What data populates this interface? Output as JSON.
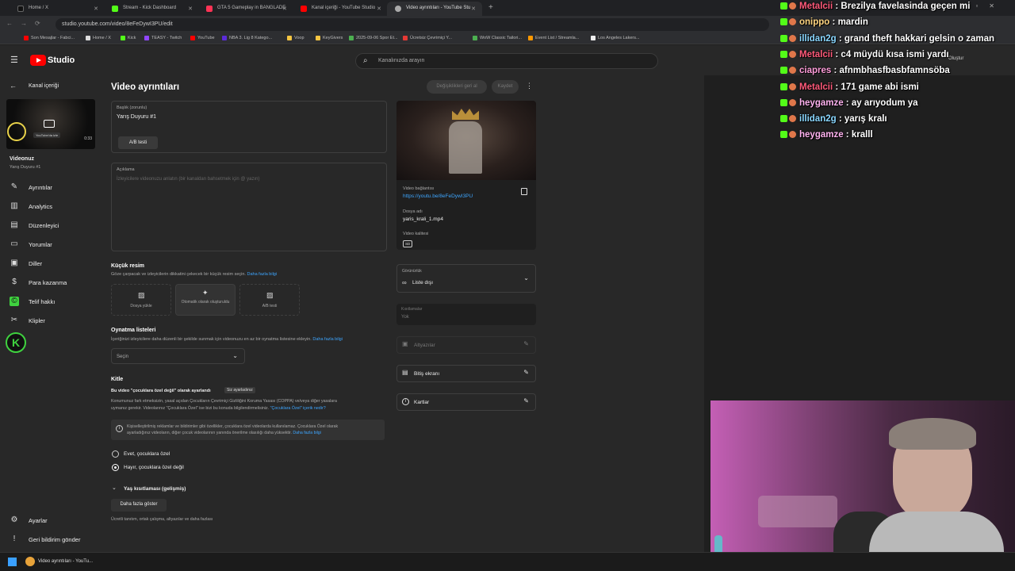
{
  "browser": {
    "tabs": [
      {
        "label": "Home / X",
        "color": "#111111"
      },
      {
        "label": "Stream - Kick Dashboard",
        "color": "#53fc18"
      },
      {
        "label": "GTA 5 Gameplay in BANGLADE",
        "color": "#ff3355"
      },
      {
        "label": "Kanal içeriği - YouTube Studio",
        "color": "#ff0000"
      },
      {
        "label": "Video ayrıntıları - YouTube Stu",
        "color": "#aaaaaa"
      }
    ],
    "url": "studio.youtube.com/video/8eFeDywI3PU/edit",
    "bookmarks": [
      {
        "label": "Son Mesajlar - Fabci...",
        "color": "#ff0000"
      },
      {
        "label": "Home / X",
        "color": "#dddddd"
      },
      {
        "label": "Kick",
        "color": "#53fc18"
      },
      {
        "label": "TEASY - Twitch",
        "color": "#9146ff"
      },
      {
        "label": "YouTube",
        "color": "#ff0000"
      },
      {
        "label": "NBA 3. Lig 8 Katego...",
        "color": "#5b2bd8"
      },
      {
        "label": "Voop",
        "color": "#f5c542"
      },
      {
        "label": "KeyGivers",
        "color": "#f5c542"
      },
      {
        "label": "2025-09-06 Spor Et...",
        "color": "#4caf50"
      },
      {
        "label": "Ücretsiz Çevrimiçi Y...",
        "color": "#e53935"
      },
      {
        "label": "WoW Classic Tailori...",
        "color": "#4caf50"
      },
      {
        "label": "Event List / Streamla...",
        "color": "#ff9800"
      },
      {
        "label": "Los Angeles Lakers...",
        "color": "#eeeeee"
      }
    ]
  },
  "header": {
    "logo": "Studio",
    "search_placeholder": "Kanalınızda arayın",
    "create_label": "Oluştur"
  },
  "sidebar": {
    "back_label": "Kanal içeriği",
    "thumb_time": "0:33",
    "thumb_tooltip": "YouTube'da izle",
    "video_heading": "Videonuz",
    "video_title": "Yarış Duyuru #1",
    "items": [
      {
        "label": "Ayrıntılar",
        "icon": "pencil-icon"
      },
      {
        "label": "Analytics",
        "icon": "analytics-icon"
      },
      {
        "label": "Düzenleyici",
        "icon": "editor-icon"
      },
      {
        "label": "Yorumlar",
        "icon": "comments-icon"
      },
      {
        "label": "Diller",
        "icon": "subtitles-icon"
      },
      {
        "label": "Para kazanma",
        "icon": "dollar-icon"
      },
      {
        "label": "Telif hakkı",
        "icon": "copyright-icon"
      },
      {
        "label": "Klipler",
        "icon": "scissors-icon"
      }
    ],
    "settings_label": "Ayarlar",
    "feedback_label": "Geri bildirim gönder"
  },
  "main": {
    "page_title": "Video ayrıntıları",
    "undo_label": "Değişiklikleri geri al",
    "save_label": "Kaydet",
    "title_field": {
      "label": "Başlık (zorunlu)",
      "value": "Yarış Duyuru #1",
      "ab_label": "A/B testi"
    },
    "description_field": {
      "label": "Açıklama",
      "placeholder": "İzleyicilere videonuzu anlatın (bir kanaldan bahsetmek için @ yazın)"
    },
    "thumbnail": {
      "heading": "Küçük resim",
      "desc": "Göze çarpacak ve izleyicilerin dikkatini çekecek bir küçük resim seçin.",
      "more": "Daha fazla bilgi",
      "options": [
        "Dosya yükle",
        "Otomatik olarak oluşturuldu",
        "A/B testi"
      ]
    },
    "playlists": {
      "heading": "Oynatma listeleri",
      "desc": "İçeriğinizi izleyicilere daha düzenli bir şekilde sunmak için videonuzu en az bir oynatma listesine ekleyin.",
      "more": "Daha fazla bilgi",
      "select": "Seçin"
    },
    "audience": {
      "heading": "Kitle",
      "status": "Bu video \"çocuklara özel değil\" olarak ayarlandı",
      "status_badge": "Siz ayarladınız",
      "desc1": "Konumunuz fark etmeksizin, yasal açıdan Çocukların Çevrimiçi Gizliliğini Koruma Yasası (COPPA) ve/veya diğer yasalara",
      "desc2": "uymanız gerekir. Videolarınız \"Çocuklara Özel\" ise bizi bu konuda bilgilendirmelisiniz.",
      "desc_link": "\"Çocuklara Özel\" içerik nedir?",
      "info1": "Kişiselleştirilmiş reklamlar ve bildirimler gibi özellikler, çocuklara özel videolarda kullanılamaz. Çocuklara Özel olarak",
      "info2": "ayarladığınız videoların, diğer çocuk videolarının yanında önerilme olasılığı daha yüksektir.",
      "info_link": "Daha fazla bilgi",
      "opt_yes": "Evet, çocuklara özel",
      "opt_no": "Hayır, çocuklara özel değil",
      "age_restriction": "Yaş kısıtlaması (gelişmiş)"
    },
    "show_more": "Daha fazla göster",
    "show_more_desc": "Ücretli tanıtım, ortak çalışma, altyazılar ve daha fazlası"
  },
  "right_panel": {
    "video_link_label": "Video bağlantısı",
    "video_link": "https://youtu.be/8eFeDywI3PU",
    "file_label": "Dosya adı",
    "file_name": "yaris_krali_1.mp4",
    "quality_label": "Video kalitesi",
    "quality_badge": "SD",
    "visibility_label": "Görünürlük",
    "visibility_value": "Liste dışı",
    "restrictions_label": "Kısıtlamalar",
    "restrictions_value": "Yok",
    "subtitles": "Altyazılar",
    "end_screen": "Bitiş ekranı",
    "cards": "Kartlar"
  },
  "chat": [
    {
      "user": "Metalcii",
      "msg": "Brezilya favelasinda geçen mi",
      "color": "#ff5a7a"
    },
    {
      "user": "onippo",
      "msg": "mardin",
      "color": "#ffd580"
    },
    {
      "user": "illidan2g",
      "msg": "grand theft hakkari gelsin o zaman",
      "color": "#8ad7ff"
    },
    {
      "user": "Metalcii",
      "msg": "c4 müydü kısa ismi yardı",
      "color": "#ff5a7a"
    },
    {
      "user": "ciapres",
      "msg": "afnmbhasfbasbfamnsöba",
      "color": "#ff9dda"
    },
    {
      "user": "Metalcii",
      "msg": "171 game abi ismi",
      "color": "#ff5a7a"
    },
    {
      "user": "heygamze",
      "msg": "ay arıyodum ya",
      "color": "#ffb3f0"
    },
    {
      "user": "illidan2g",
      "msg": "yarış kralı",
      "color": "#8ad7ff"
    },
    {
      "user": "heygamze",
      "msg": "kralll",
      "color": "#ffb3f0"
    }
  ],
  "taskbar": {
    "active_window": "Video ayrıntıları - YouTu..."
  }
}
